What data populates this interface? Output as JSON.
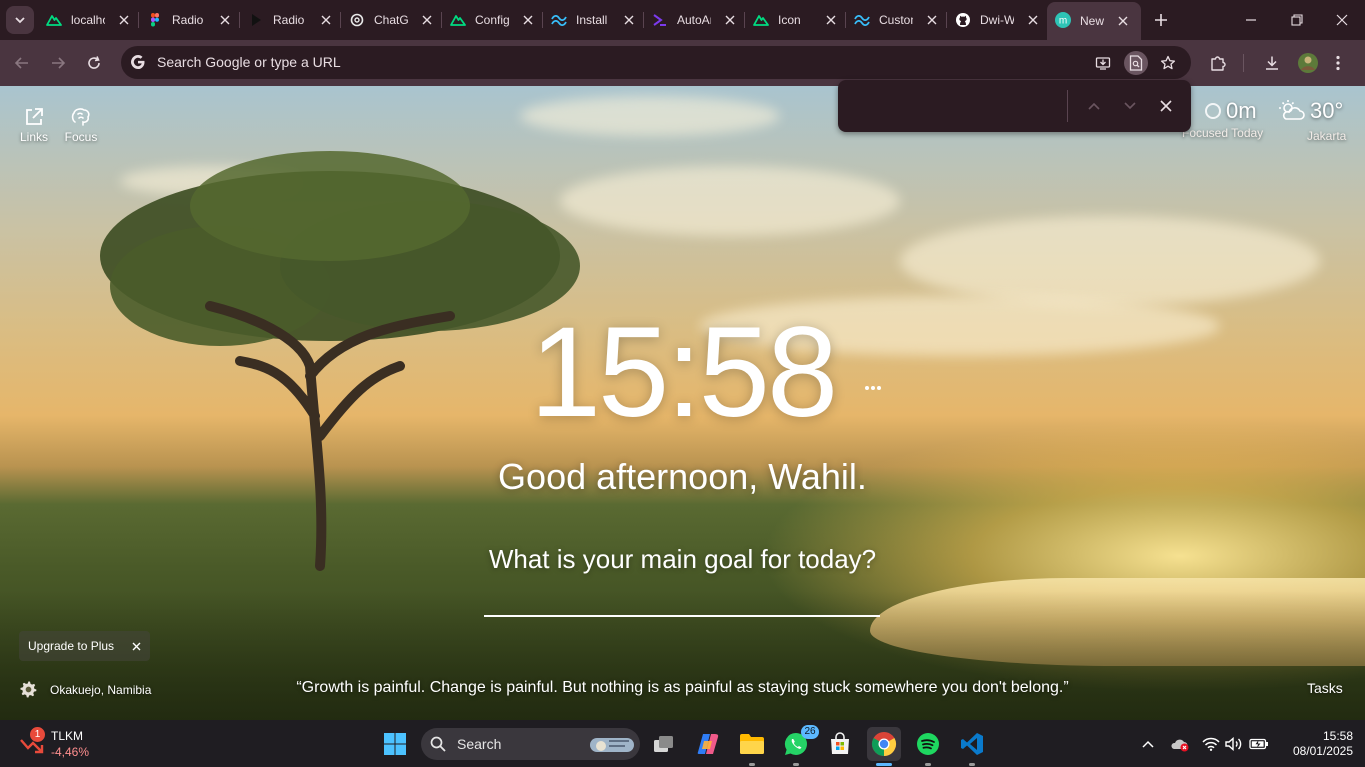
{
  "browser": {
    "tabs": [
      {
        "title": "localhost",
        "icon": "nuxt-icon",
        "color": "#00dc82"
      },
      {
        "title": "Radio",
        "icon": "figma-icon",
        "color": "#f24e1e"
      },
      {
        "title": "Radio",
        "icon": "play-icon",
        "color": "#111111"
      },
      {
        "title": "ChatGPT",
        "icon": "openai-icon",
        "color": "#e8e8e8"
      },
      {
        "title": "Config",
        "icon": "nuxt-icon",
        "color": "#00dc82"
      },
      {
        "title": "Install",
        "icon": "tailwind-icon",
        "color": "#38bdf8"
      },
      {
        "title": "AutoAnimate",
        "icon": "autoanimate-icon",
        "color": "#7c3aed"
      },
      {
        "title": "Icon",
        "icon": "nuxt-icon",
        "color": "#00dc82"
      },
      {
        "title": "Custom",
        "icon": "tailwind-icon",
        "color": "#38bdf8"
      },
      {
        "title": "Dwi-W",
        "icon": "github-icon",
        "color": "#ffffff"
      },
      {
        "title": "New Tab",
        "icon": "momentum-icon",
        "color": "#2ec4b6"
      }
    ],
    "omnibox": {
      "placeholder": "Search Google or type a URL"
    }
  },
  "momentum": {
    "links_label": "Links",
    "focus_label": "Focus",
    "focus_value": "0m",
    "focus_sub": "Focused Today",
    "weather_temp": "30°",
    "weather_city": "Jakarta",
    "time": "15:58",
    "greeting": "Good afternoon, Wahil.",
    "goal_question": "What is your main goal for today?",
    "upgrade_label": "Upgrade to Plus",
    "location": "Okakuejo, Namibia",
    "quote": "“Growth is painful. Change is painful. But nothing is as painful as staying stuck somewhere you don't belong.”",
    "tasks_label": "Tasks"
  },
  "taskbar": {
    "stock_name": "TLKM",
    "stock_change": "-4,46%",
    "stock_badge": "1",
    "search_label": "Search",
    "whatsapp_badge": "26",
    "clock_time": "15:58",
    "clock_date": "08/01/2025"
  }
}
